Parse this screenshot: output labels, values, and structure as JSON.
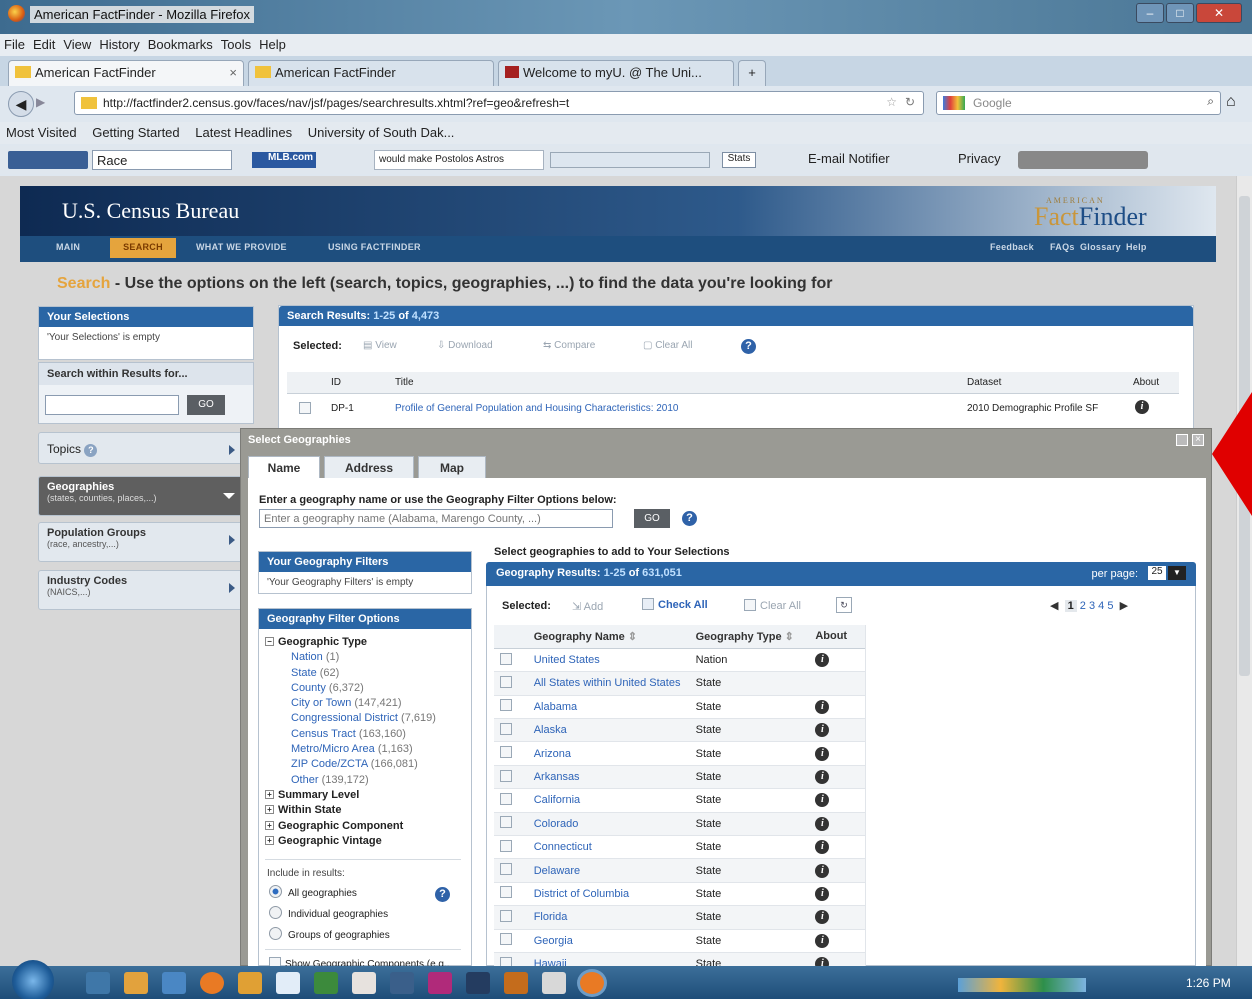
{
  "browser": {
    "window_title": "American FactFinder - Mozilla Firefox",
    "menu": [
      "File",
      "Edit",
      "View",
      "History",
      "Bookmarks",
      "Tools",
      "Help"
    ],
    "tabs": [
      {
        "label": "American FactFinder"
      },
      {
        "label": "American FactFinder"
      },
      {
        "label": "Welcome to myU. @ The Uni..."
      }
    ],
    "new_tab": "+",
    "url": "http://factfinder2.census.gov/faces/nav/jsf/pages/searchresults.xhtml?ref=geo&refresh=t",
    "search_engine": "Google",
    "bookmarks": [
      "Most Visited",
      "Getting Started",
      "Latest Headlines",
      "University of South Dak..."
    ],
    "toolbar": {
      "race_field": "Race",
      "mlb_label": "MLB.com",
      "news_ticker": "would make Postolos Astros",
      "stats": "Stats",
      "email_notifier": "E-mail Notifier",
      "privacy": "Privacy"
    }
  },
  "site": {
    "agency": "U.S. Census Bureau",
    "logo_top": "AMERICAN",
    "logo_fact": "Fact",
    "logo_finder": "Finder",
    "nav": [
      "MAIN",
      "SEARCH",
      "WHAT WE PROVIDE",
      "USING FACTFINDER"
    ],
    "nav_right": [
      "Feedback",
      "FAQs",
      "Glossary",
      "Help"
    ],
    "heading_search": "Search",
    "heading_rest": " - Use the options on the left (search, topics, geographies, ...) to find the data you're looking for"
  },
  "left": {
    "your_selections": "Your Selections",
    "selections_empty": "'Your Selections' is empty",
    "search_within": "Search within Results for...",
    "go": "GO",
    "topics": "Topics",
    "geographies": "Geographies",
    "geographies_sub": "(states, counties, places,...)",
    "population_groups": "Population Groups",
    "population_sub": "(race, ancestry,...)",
    "industry_codes": "Industry Codes",
    "industry_sub": "(NAICS,...)"
  },
  "results": {
    "header_prefix": "Search Results:",
    "range": "1-25",
    "of": "of",
    "total": "4,473",
    "selected": "Selected:",
    "actions": [
      "View",
      "Download",
      "Compare",
      "Clear All"
    ],
    "columns": [
      "ID",
      "Title",
      "Dataset",
      "About"
    ],
    "row": {
      "id": "DP-1",
      "title": "Profile of General Population and Housing Characteristics: 2010",
      "dataset": "2010 Demographic Profile SF"
    }
  },
  "modal": {
    "title": "Select Geographies",
    "tabs": [
      "Name",
      "Address",
      "Map"
    ],
    "prompt": "Enter a geography name or use the Geography Filter Options below:",
    "placeholder": "Enter a geography name (Alabama, Marengo County, ...)",
    "go": "GO",
    "your_filters": "Your Geography Filters",
    "filters_empty": "'Your Geography Filters' is empty",
    "filter_options": "Geography Filter Options",
    "geo_type": "Geographic Type",
    "types": [
      {
        "name": "Nation",
        "count": "(1)"
      },
      {
        "name": "State",
        "count": "(62)"
      },
      {
        "name": "County",
        "count": "(6,372)"
      },
      {
        "name": "City or Town",
        "count": "(147,421)"
      },
      {
        "name": "Congressional District",
        "count": "(7,619)"
      },
      {
        "name": "Census Tract",
        "count": "(163,160)"
      },
      {
        "name": "Metro/Micro Area",
        "count": "(1,163)"
      },
      {
        "name": "ZIP Code/ZCTA",
        "count": "(166,081)"
      },
      {
        "name": "Other",
        "count": "(139,172)"
      }
    ],
    "collapsed": [
      "Summary Level",
      "Within State",
      "Geographic Component",
      "Geographic Vintage"
    ],
    "include_label": "Include in results:",
    "include_options": [
      "All geographies",
      "Individual geographies",
      "Groups of geographies"
    ],
    "show_components": "Show Geographic Components (e.g.,",
    "select_prompt": "Select geographies to add to Your Selections",
    "results_prefix": "Geography Results:",
    "results_range": "1-25",
    "results_of": "of",
    "results_total": "631,051",
    "per_page_label": "per page:",
    "per_page": "25",
    "selected": "Selected:",
    "add": "Add",
    "check_all": "Check All",
    "clear_all": "Clear All",
    "pages": [
      "1",
      "2",
      "3",
      "4",
      "5"
    ],
    "columns": [
      "Geography Name",
      "Geography Type",
      "About"
    ],
    "rows": [
      {
        "name": "United States",
        "type": "Nation",
        "info": true
      },
      {
        "name": "All States within United States",
        "type": "State",
        "info": false
      },
      {
        "name": "Alabama",
        "type": "State",
        "info": true
      },
      {
        "name": "Alaska",
        "type": "State",
        "info": true
      },
      {
        "name": "Arizona",
        "type": "State",
        "info": true
      },
      {
        "name": "Arkansas",
        "type": "State",
        "info": true
      },
      {
        "name": "California",
        "type": "State",
        "info": true
      },
      {
        "name": "Colorado",
        "type": "State",
        "info": true
      },
      {
        "name": "Connecticut",
        "type": "State",
        "info": true
      },
      {
        "name": "Delaware",
        "type": "State",
        "info": true
      },
      {
        "name": "District of Columbia",
        "type": "State",
        "info": true
      },
      {
        "name": "Florida",
        "type": "State",
        "info": true
      },
      {
        "name": "Georgia",
        "type": "State",
        "info": true
      },
      {
        "name": "Hawaii",
        "type": "State",
        "info": true
      }
    ]
  },
  "taskbar": {
    "clock": "1:26 PM"
  },
  "colors": {
    "accent": "#2a66a5",
    "search_tab": "#e5a43d",
    "arrow": "#e00000"
  }
}
